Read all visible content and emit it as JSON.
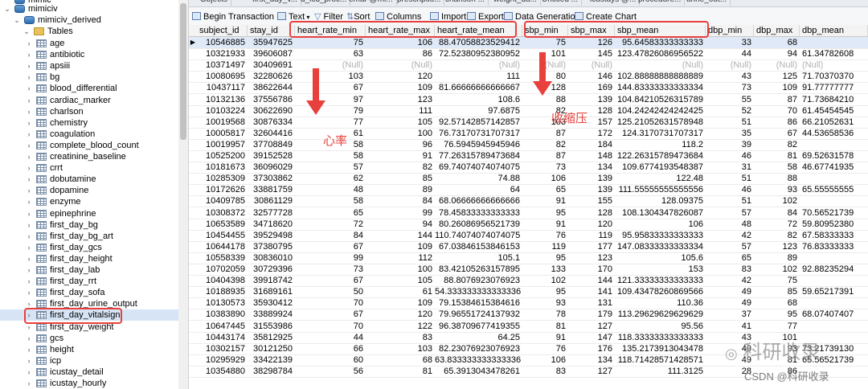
{
  "sidebar": {
    "top_partial": "mimic",
    "db_name": "mimiciv",
    "schema_name": "mimiciv_derived",
    "tables_label": "Tables",
    "tables": [
      "age",
      "antibiotic",
      "apsiii",
      "bg",
      "blood_differential",
      "cardiac_marker",
      "charlson",
      "chemistry",
      "coagulation",
      "complete_blood_count",
      "creatinine_baseline",
      "crrt",
      "dobutamine",
      "dopamine",
      "enzyme",
      "epinephrine",
      "first_day_bg",
      "first_day_bg_art",
      "first_day_gcs",
      "first_day_height",
      "first_day_lab",
      "first_day_rrt",
      "first_day_sofa",
      "first_day_urine_output",
      "first_day_vitalsign",
      "first_day_weight",
      "gcs",
      "height",
      "icp",
      "icustay_detail",
      "icustay_hourly"
    ],
    "selected_table": "first_day_vitalsign"
  },
  "tabs": [
    "Objects",
    "first_day_v...",
    "d_icd_proc...",
    "emar @mi...",
    "prescriptio...",
    "charlson ...",
    "weight_du...",
    "Untitled ...",
    "icustays @...",
    "procedure...",
    "urine_out..."
  ],
  "toolbar": {
    "begin_transaction": "Begin Transaction",
    "text": "Text",
    "filter": "Filter",
    "sort": "Sort",
    "columns": "Columns",
    "import": "Import",
    "export": "Export",
    "data_generation": "Data Generation",
    "create_chart": "Create Chart"
  },
  "columns": [
    "subject_id",
    "stay_id",
    "heart_rate_min",
    "heart_rate_max",
    "heart_rate_mean",
    "sbp_min",
    "sbp_max",
    "sbp_mean",
    "dbp_min",
    "dbp_max",
    "dbp_mean"
  ],
  "rows": [
    [
      "10546885",
      "35947625",
      "75",
      "106",
      "88.47058823529412",
      "75",
      "126",
      "95.64583333333333",
      "33",
      "68",
      ""
    ],
    [
      "10321933",
      "39606087",
      "63",
      "86",
      "72.52380952380952",
      "101",
      "145",
      "123.47826086956522",
      "44",
      "94",
      "61.34782608"
    ],
    [
      "10371497",
      "30409691",
      "(Null)",
      "(Null)",
      "(Null)",
      "(Null)",
      "(Null)",
      "(Null)",
      "(Null)",
      "(Null)",
      "(Null)"
    ],
    [
      "10080695",
      "32280626",
      "103",
      "120",
      "111",
      "80",
      "146",
      "102.88888888888889",
      "43",
      "125",
      "71.70370370"
    ],
    [
      "10437117",
      "38622644",
      "67",
      "109",
      "81.66666666666667",
      "128",
      "169",
      "144.83333333333334",
      "73",
      "109",
      "91.77777777"
    ],
    [
      "10132136",
      "37556786",
      "97",
      "123",
      "108.6",
      "88",
      "139",
      "104.84210526315789",
      "55",
      "87",
      "71.73684210"
    ],
    [
      "10103224",
      "30622690",
      "79",
      "111",
      "97.6875",
      "82",
      "128",
      "104.24242424242425",
      "52",
      "70",
      "61.45454545"
    ],
    [
      "10019568",
      "30876334",
      "77",
      "105",
      "92.57142857142857",
      "103",
      "157",
      "125.21052631578948",
      "51",
      "86",
      "66.21052631"
    ],
    [
      "10005817",
      "32604416",
      "61",
      "100",
      "76.73170731707317",
      "87",
      "172",
      "124.3170731707317",
      "35",
      "67",
      "44.53658536"
    ],
    [
      "10019957",
      "37708849",
      "58",
      "96",
      "76.5945945945946",
      "82",
      "184",
      "118.2",
      "39",
      "82",
      ""
    ],
    [
      "10525200",
      "39152528",
      "58",
      "91",
      "77.26315789473684",
      "87",
      "148",
      "122.26315789473684",
      "46",
      "81",
      "69.52631578"
    ],
    [
      "10181673",
      "36096029",
      "57",
      "82",
      "69.74074074074075",
      "73",
      "134",
      "109.6774193548387",
      "31",
      "58",
      "46.67741935"
    ],
    [
      "10285309",
      "37303862",
      "62",
      "85",
      "74.88",
      "106",
      "139",
      "122.48",
      "51",
      "88",
      ""
    ],
    [
      "10172626",
      "33881759",
      "48",
      "89",
      "64",
      "65",
      "139",
      "111.55555555555556",
      "46",
      "93",
      "65.55555555"
    ],
    [
      "10409785",
      "30861129",
      "58",
      "84",
      "68.06666666666666",
      "91",
      "155",
      "128.09375",
      "51",
      "102",
      ""
    ],
    [
      "10308372",
      "32577728",
      "65",
      "99",
      "78.45833333333333",
      "95",
      "128",
      "108.1304347826087",
      "57",
      "84",
      "70.56521739"
    ],
    [
      "10653589",
      "34718620",
      "72",
      "94",
      "80.26086956521739",
      "91",
      "120",
      "106",
      "48",
      "72",
      "59.80952380"
    ],
    [
      "10454455",
      "39529498",
      "84",
      "144",
      "110.74074074074075",
      "76",
      "119",
      "95.95833333333333",
      "42",
      "82",
      "67.58333333"
    ],
    [
      "10644178",
      "37380795",
      "67",
      "109",
      "67.03846153846153",
      "119",
      "177",
      "147.08333333333334",
      "57",
      "123",
      "76.83333333"
    ],
    [
      "10558339",
      "30836010",
      "99",
      "112",
      "105.1",
      "95",
      "123",
      "105.6",
      "65",
      "89",
      ""
    ],
    [
      "10702059",
      "30729396",
      "73",
      "100",
      "83.42105263157895",
      "133",
      "170",
      "153",
      "83",
      "102",
      "92.88235294"
    ],
    [
      "10404398",
      "39918742",
      "67",
      "105",
      "88.8076923076923",
      "102",
      "144",
      "121.33333333333333",
      "42",
      "75",
      ""
    ],
    [
      "10188935",
      "31689161",
      "50",
      "61",
      "54.333333333333336",
      "95",
      "141",
      "109.43478260869566",
      "49",
      "85",
      "59.65217391"
    ],
    [
      "10130573",
      "35930412",
      "70",
      "109",
      "79.15384615384616",
      "93",
      "131",
      "110.36",
      "49",
      "68",
      ""
    ],
    [
      "10383890",
      "33889924",
      "67",
      "120",
      "79.96551724137932",
      "78",
      "179",
      "113.29629629629629",
      "37",
      "95",
      "68.07407407"
    ],
    [
      "10647445",
      "31553986",
      "70",
      "122",
      "96.38709677419355",
      "81",
      "127",
      "95.56",
      "41",
      "77",
      ""
    ],
    [
      "10443174",
      "35812925",
      "44",
      "83",
      "64.25",
      "91",
      "147",
      "118.33333333333333",
      "43",
      "101",
      ""
    ],
    [
      "10302157",
      "30121250",
      "66",
      "103",
      "82.23076923076923",
      "76",
      "176",
      "135.2173913043478",
      "49",
      "93",
      "73.21739130"
    ],
    [
      "10295929",
      "33422139",
      "60",
      "68",
      "63.833333333333336",
      "106",
      "134",
      "118.71428571428571",
      "49",
      "81",
      "65.56521739"
    ],
    [
      "10354880",
      "38298784",
      "56",
      "81",
      "65.3913043478261",
      "83",
      "127",
      "111.3125",
      "28",
      "86",
      ""
    ]
  ],
  "annotations": {
    "heart_rate": "心率",
    "sbp": "收缩压"
  },
  "watermark": {
    "line1": "科研收录",
    "line2": "CSDN @科研收录"
  },
  "colors": {
    "annotation_red": "#e8403c",
    "selection_blue": "#dfe9f7"
  }
}
